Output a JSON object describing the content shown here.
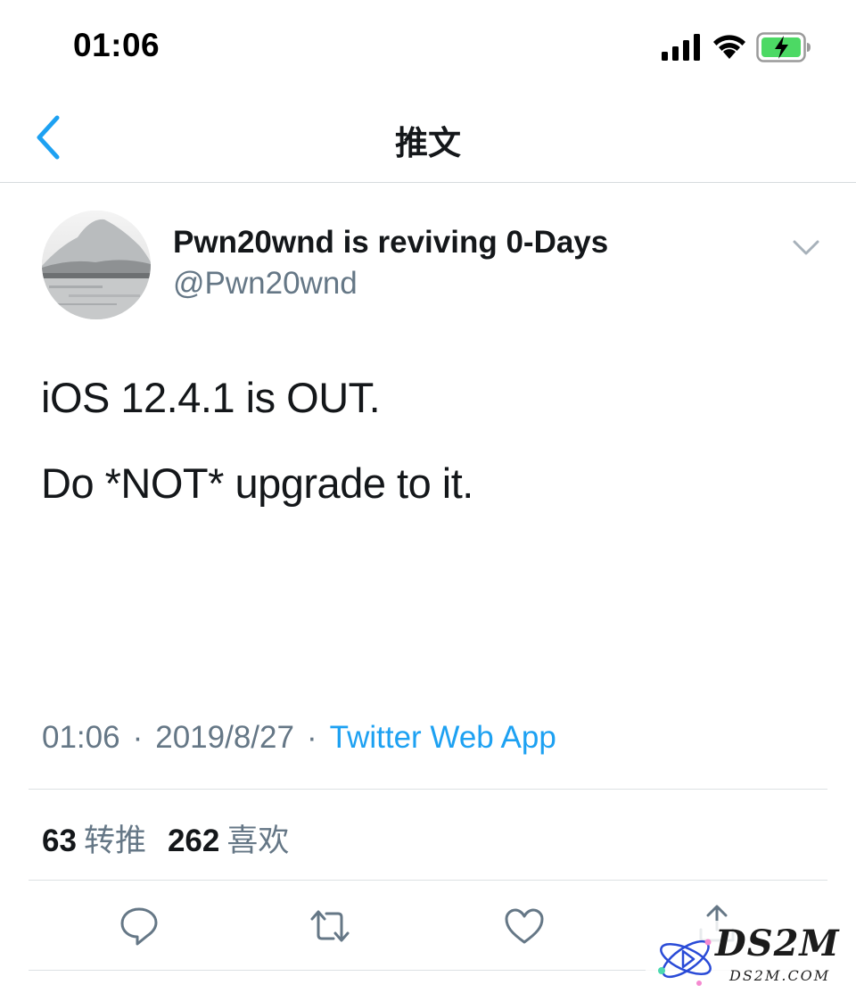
{
  "status_bar": {
    "time": "01:06",
    "icons": [
      "signal-icon",
      "wifi-icon",
      "battery-charging-icon"
    ],
    "battery_color": "#4cd964"
  },
  "nav": {
    "title": "推文",
    "back_icon": "chevron-left-icon",
    "accent_color": "#1da1f2"
  },
  "tweet": {
    "display_name": "Pwn20wnd is reviving 0-Days",
    "handle": "@Pwn20wnd",
    "lines": [
      "iOS 12.4.1 is OUT.",
      "Do *NOT* upgrade to it."
    ],
    "time": "01:06",
    "date": "2019/8/27",
    "separator": "·",
    "source": "Twitter Web App",
    "retweet_count": "63",
    "retweet_label": "转推",
    "like_count": "262",
    "like_label": "喜欢"
  },
  "actions": [
    "reply-icon",
    "retweet-icon",
    "like-icon",
    "share-icon"
  ],
  "watermark": {
    "text": "DS2M",
    "sub": "DS2M.COM"
  }
}
